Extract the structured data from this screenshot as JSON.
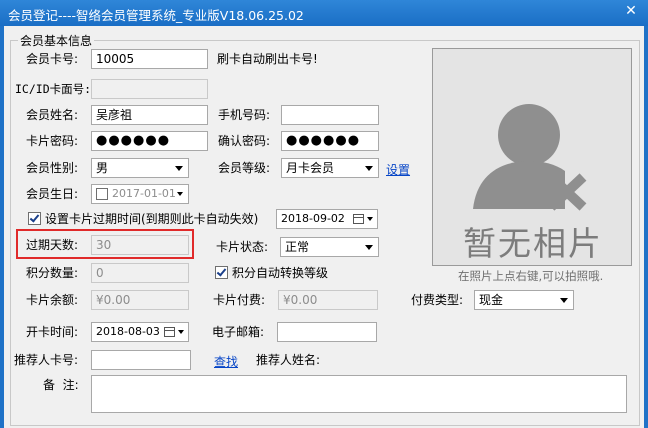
{
  "window": {
    "title": "会员登记----智络会员管理系统_专业版V18.06.25.02",
    "close": "✕"
  },
  "group": {
    "legend": "会员基本信息"
  },
  "form": {
    "card_no_label": "会员卡号:",
    "card_no_value": "10005",
    "card_hint": "刷卡自动刷出卡号!",
    "ic_label": "IC/ID卡面号:",
    "ic_value": "",
    "name_label": "会员姓名:",
    "name_value": "吴彦祖",
    "phone_label": "手机号码:",
    "phone_value": "",
    "password_label": "卡片密码:",
    "password_value": "●●●●●●",
    "confirm_label": "确认密码:",
    "confirm_value": "●●●●●●",
    "gender_label": "会员性别:",
    "gender_value": "男",
    "level_label": "会员等级:",
    "level_value": "月卡会员",
    "level_settings_link": "设置",
    "birthday_label": "会员生日:",
    "birthday_value": "2017-01-01",
    "expire_check_label": "设置卡片过期时间(到期则此卡自动失效)",
    "expire_date_value": "2018-09-02",
    "expire_days_label": "过期天数:",
    "expire_days_value": "30",
    "card_status_label": "卡片状态:",
    "card_status_value": "正常",
    "points_label": "积分数量:",
    "points_value": "0",
    "auto_level_label": "积分自动转换等级",
    "balance_label": "卡片余额:",
    "balance_value": "¥0.00",
    "paid_label": "卡片付费:",
    "paid_value": "¥0.00",
    "pay_type_label": "付费类型:",
    "pay_type_value": "现金",
    "open_time_label": "开卡时间:",
    "open_time_value": "2018-08-03",
    "email_label": "电子邮箱:",
    "email_value": "",
    "referrer_card_label": "推荐人卡号:",
    "referrer_card_value": "",
    "find_link": "查找",
    "referrer_name_label": "推荐人姓名:",
    "note_label": "备  注:",
    "note_value": ""
  },
  "photo": {
    "placeholder": "暂无相片",
    "hint": "在照片上点右键,可以拍照哦."
  },
  "colors": {
    "title_bar": "#1a6ec5",
    "highlight_border": "#e02a2a",
    "link": "#0645c7"
  }
}
